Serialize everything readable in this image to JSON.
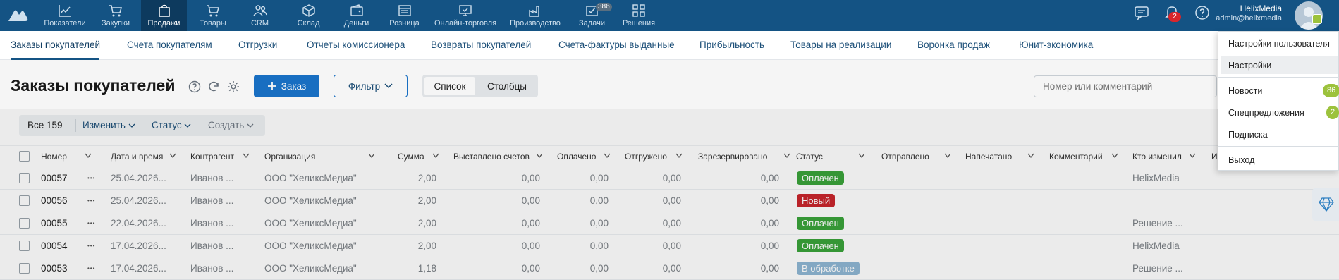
{
  "topnav": {
    "items": [
      {
        "label": "Показатели",
        "icon": "chart-line-icon"
      },
      {
        "label": "Закупки",
        "icon": "cart-icon"
      },
      {
        "label": "Продажи",
        "icon": "bag-icon",
        "active": true
      },
      {
        "label": "Товары",
        "icon": "cart-icon"
      },
      {
        "label": "CRM",
        "icon": "people-icon"
      },
      {
        "label": "Склад",
        "icon": "box-icon"
      },
      {
        "label": "Деньги",
        "icon": "wallet-icon"
      },
      {
        "label": "Розница",
        "icon": "store-icon"
      },
      {
        "label": "Онлайн-торговля",
        "icon": "monitor-icon"
      },
      {
        "label": "Производство",
        "icon": "factory-icon"
      },
      {
        "label": "Задачи",
        "icon": "check-icon",
        "badge": "386"
      },
      {
        "label": "Решения",
        "icon": "grid-icon"
      }
    ],
    "bell_badge": "2",
    "user_name": "HelixMedia",
    "user_email": "admin@helixmedia"
  },
  "subnav": {
    "tabs": [
      "Заказы покупателей",
      "Счета покупателям",
      "Отгрузки",
      "Отчеты комиссионера",
      "Возвраты покупателей",
      "Счета-фактуры выданные",
      "Прибыльность",
      "Товары на реализации",
      "Воронка продаж",
      "Юнит-экономика"
    ]
  },
  "heading": {
    "title": "Заказы покупателей",
    "order_button": "Заказ",
    "filter_button": "Фильтр",
    "view_list": "Список",
    "view_columns": "Столбцы",
    "search_placeholder": "Номер или комментарий"
  },
  "toolbar": {
    "all": "Все 159",
    "edit": "Изменить",
    "status": "Статус",
    "create": "Создать"
  },
  "table": {
    "columns": [
      "Номер",
      "Дата и время",
      "Контрагент",
      "Организация",
      "Сумма",
      "Выставлено счетов",
      "Оплачено",
      "Отгружено",
      "Зарезервировано",
      "Статус",
      "Отправлено",
      "Напечатано",
      "Комментарий",
      "Кто изменил",
      "И"
    ],
    "rows": [
      {
        "num": "00057",
        "date": "25.04.2026...",
        "agent": "Иванов ...",
        "org": "ООО \"ХеликсМедиа\"",
        "sum": "2,00",
        "invoiced": "0,00",
        "paid": "0,00",
        "shipped": "0,00",
        "reserved": "0,00",
        "status": "Оплачен",
        "status_color": "#3aa33a",
        "changed_by": "HelixMedia"
      },
      {
        "num": "00056",
        "date": "25.04.2026...",
        "agent": "Иванов ...",
        "org": "ООО \"ХеликсМедиа\"",
        "sum": "2,00",
        "invoiced": "0,00",
        "paid": "0,00",
        "shipped": "0,00",
        "reserved": "0,00",
        "status": "Новый",
        "status_color": "#c9252c",
        "changed_by": ""
      },
      {
        "num": "00055",
        "date": "22.04.2026...",
        "agent": "Иванов ...",
        "org": "ООО \"ХеликсМедиа\"",
        "sum": "2,00",
        "invoiced": "0,00",
        "paid": "0,00",
        "shipped": "0,00",
        "reserved": "0,00",
        "status": "Оплачен",
        "status_color": "#3aa33a",
        "changed_by": "Решение ..."
      },
      {
        "num": "00054",
        "date": "17.04.2026...",
        "agent": "Иванов ...",
        "org": "ООО \"ХеликсМедиа\"",
        "sum": "2,00",
        "invoiced": "0,00",
        "paid": "0,00",
        "shipped": "0,00",
        "reserved": "0,00",
        "status": "Оплачен",
        "status_color": "#3aa33a",
        "changed_by": "HelixMedia"
      },
      {
        "num": "00053",
        "date": "17.04.2026...",
        "agent": "Иванов ...",
        "org": "ООО \"ХеликсМедиа\"",
        "sum": "1,18",
        "invoiced": "0,00",
        "paid": "0,00",
        "shipped": "0,00",
        "reserved": "0,00",
        "status": "В обработке",
        "status_color": "#8fb7d4",
        "changed_by": "Решение ..."
      }
    ]
  },
  "menu": {
    "user_settings": "Настройки пользователя",
    "settings": "Настройки",
    "news": "Новости",
    "news_badge": "86",
    "offers": "Спецпредложения",
    "offers_badge": "2",
    "subscription": "Подписка",
    "logout": "Выход"
  }
}
